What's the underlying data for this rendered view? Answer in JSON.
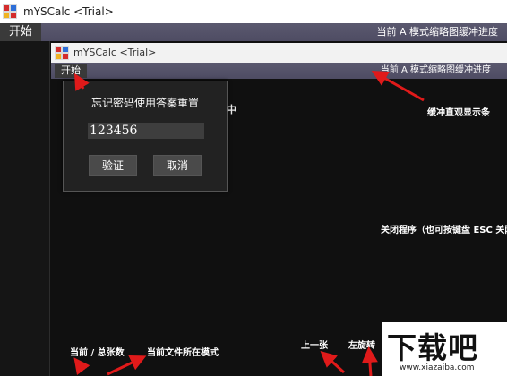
{
  "window": {
    "title": "mYSCalc <Trial>",
    "menu_start": "开始",
    "status": "当前 A 模式缩略图缓冲进度"
  },
  "inner_window": {
    "title": "mYSCalc <Trial>",
    "menu_start": "开始",
    "status": "当前 A 模式缩略图缓冲进度"
  },
  "dialog": {
    "message": "忘记密码使用答案重置",
    "password_value": "123456",
    "verify_label": "验证",
    "cancel_label": "取消"
  },
  "background": {
    "partial_label": "中"
  },
  "annotations": {
    "buffer_bar": "缓冲直观显示条",
    "close_program": "关闭程序（也可按键盘 ESC 关闭",
    "current_total": "当前 / 总张数",
    "current_mode": "当前文件所在模式",
    "previous": "上一张",
    "rotate_left": "左旋转"
  },
  "watermark": {
    "text": "下载吧",
    "url": "www.xiazaiba.com"
  },
  "colors": {
    "accent_arrow": "#e01a1a",
    "menubar": "#5b596f",
    "background": "#101010"
  }
}
